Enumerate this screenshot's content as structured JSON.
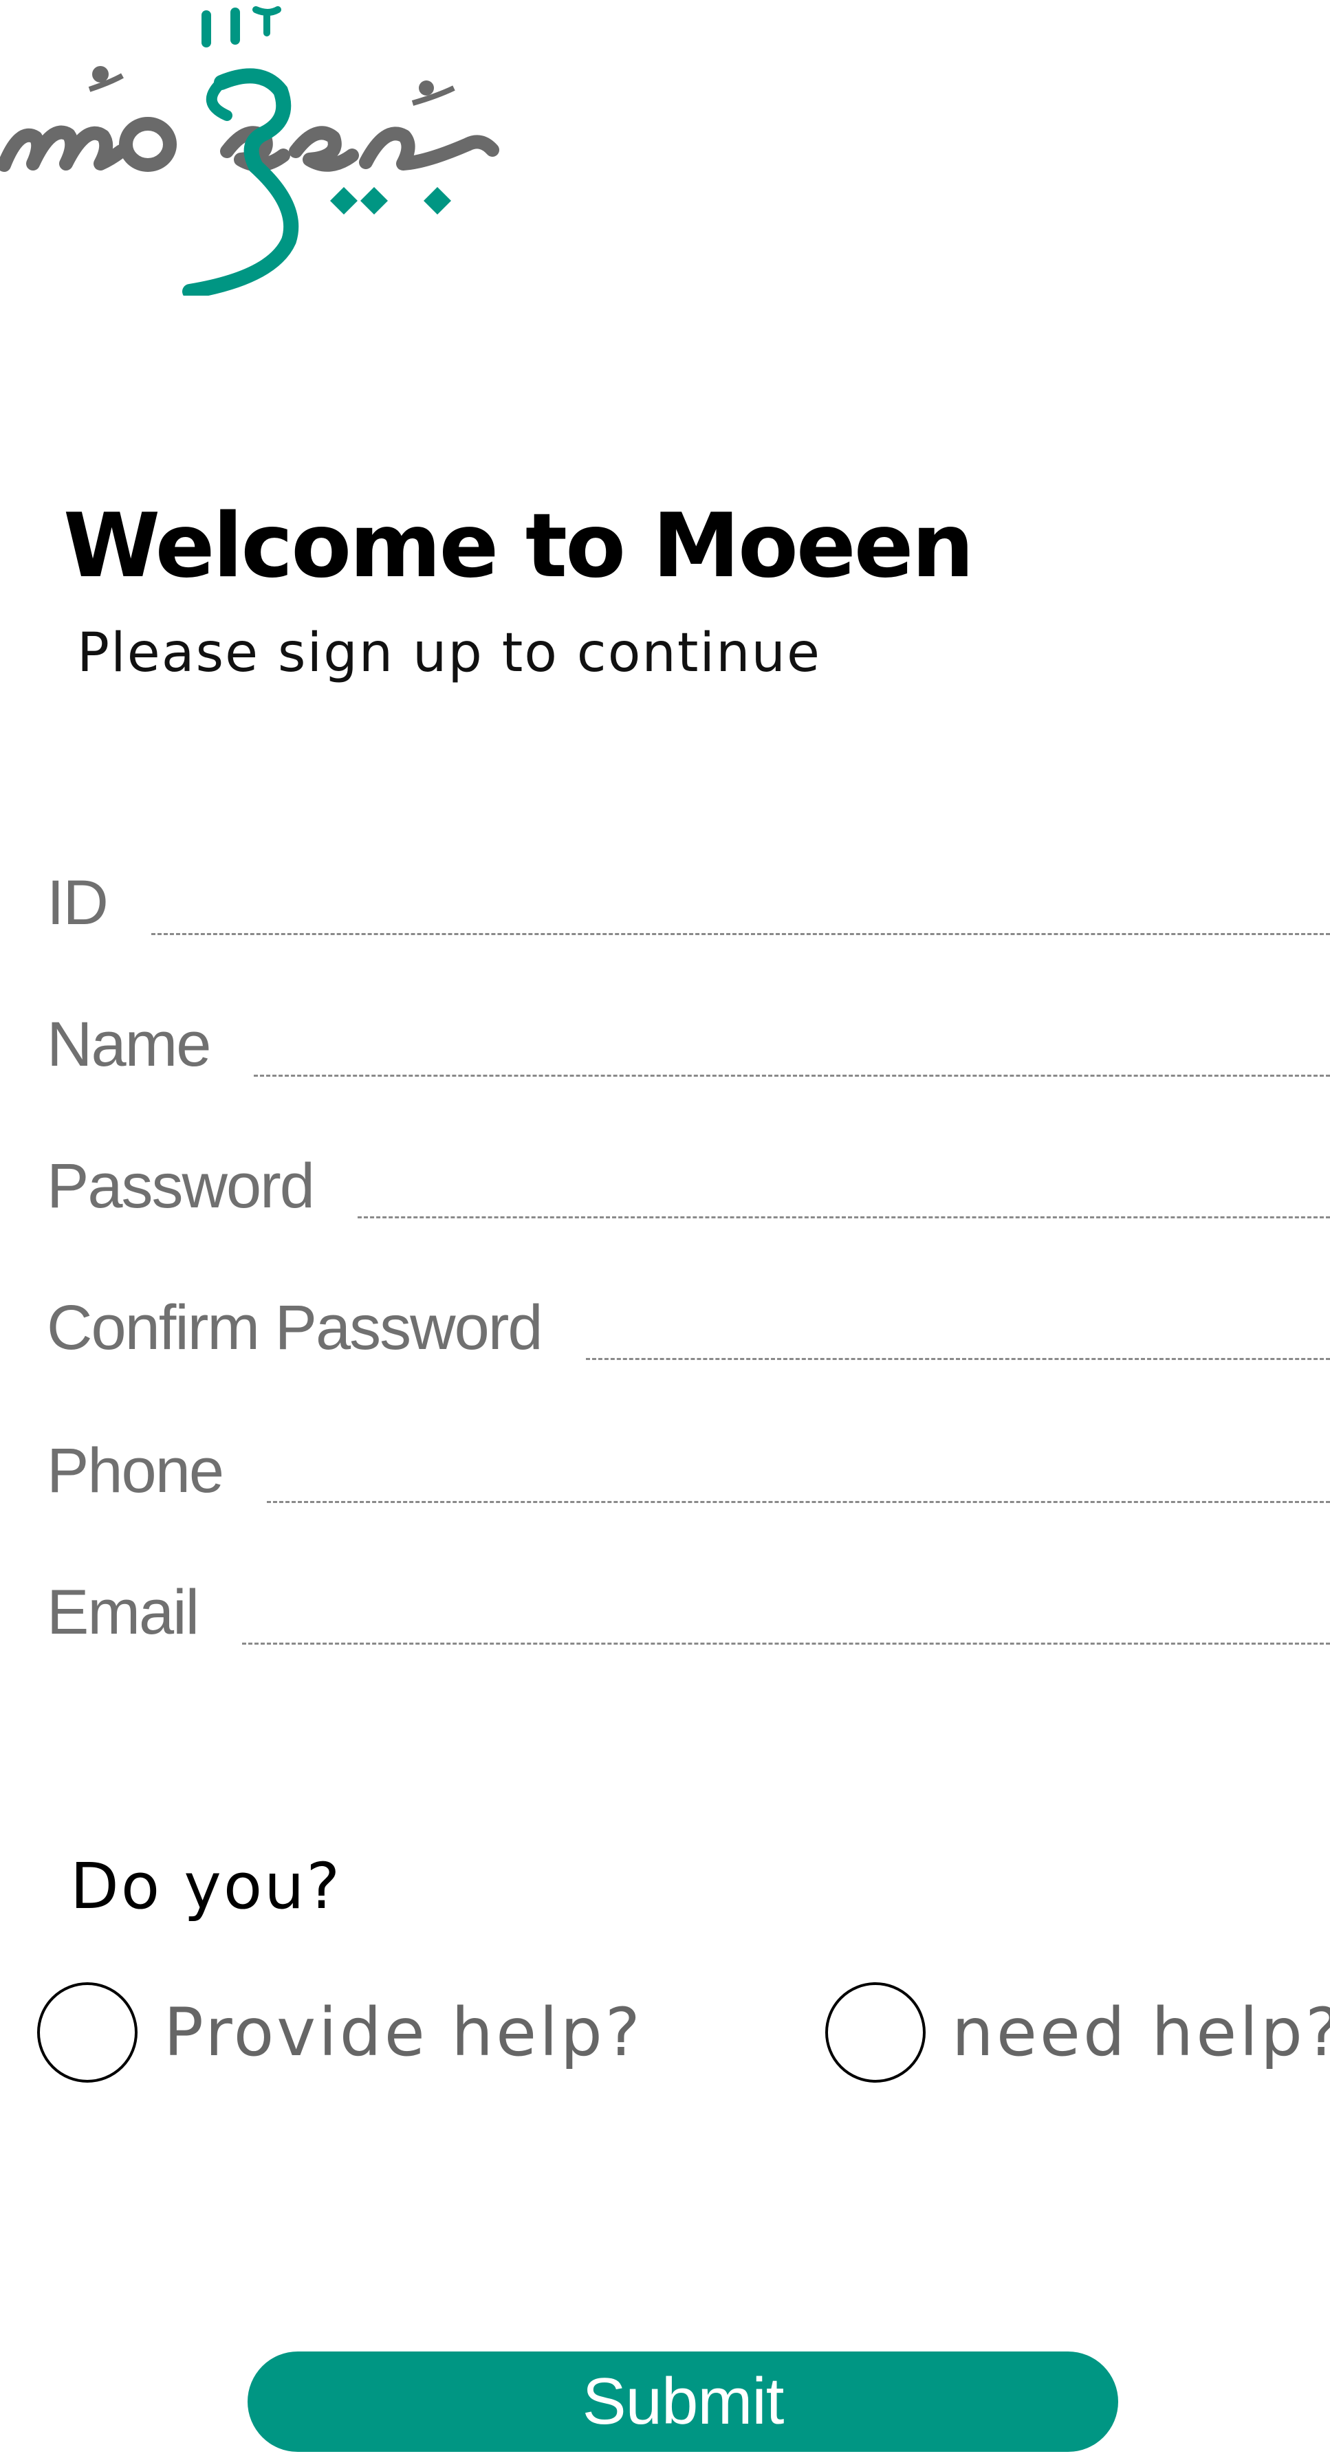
{
  "logo": {
    "wordmark": "moeen",
    "colors": {
      "gray": "#6a6a6a",
      "teal": "#009683"
    }
  },
  "header": {
    "title": "Welcome to Moeen",
    "subtitle": "Please sign up to continue"
  },
  "form": {
    "fields": [
      {
        "label": "ID",
        "value": ""
      },
      {
        "label": "Name",
        "value": ""
      },
      {
        "label": "Password",
        "value": ""
      },
      {
        "label": "Confirm Password",
        "value": ""
      },
      {
        "label": "Phone",
        "value": ""
      },
      {
        "label": "Email",
        "value": ""
      }
    ]
  },
  "role": {
    "question": "Do you?",
    "options": [
      {
        "label": "Provide help?",
        "selected": false
      },
      {
        "label": "need help?",
        "selected": false
      }
    ]
  },
  "submit": {
    "label": "Submit",
    "color": "#009683"
  }
}
